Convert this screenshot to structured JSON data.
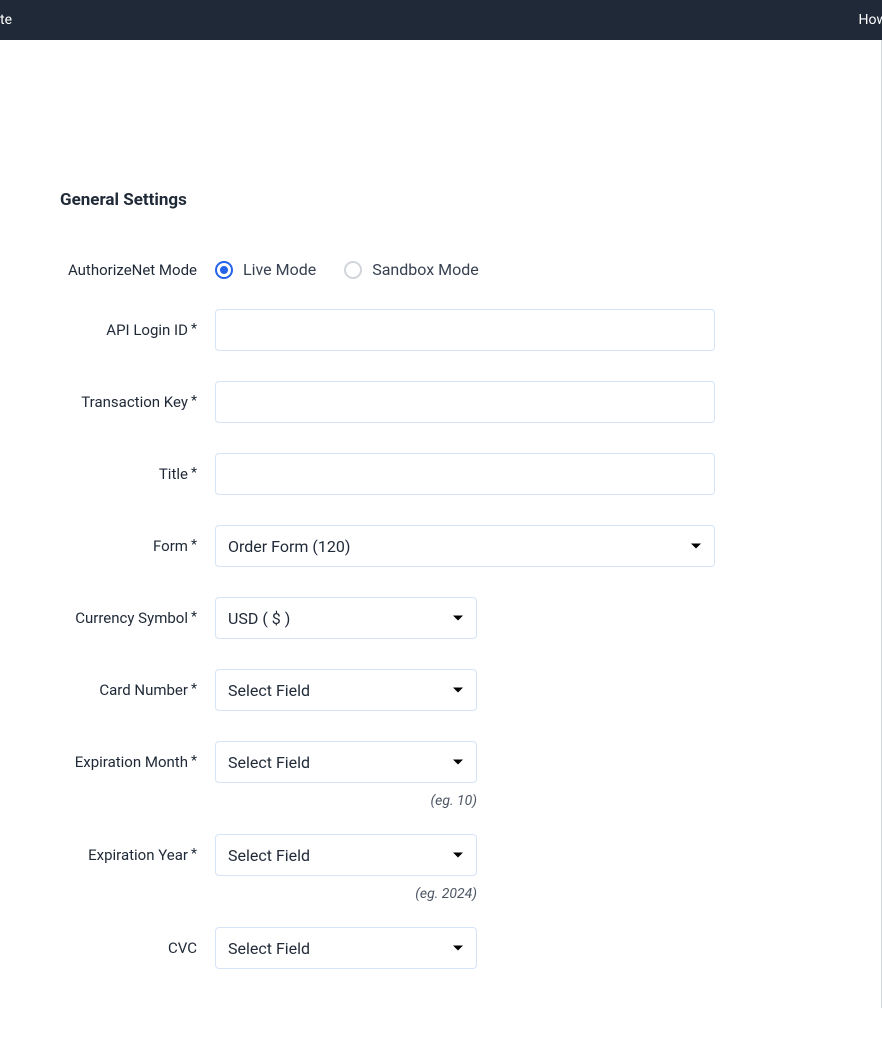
{
  "topbar": {
    "left_text": "te",
    "right_text": "How"
  },
  "section_title": "General Settings",
  "fields": {
    "mode": {
      "label": "AuthorizeNet Mode",
      "option1": "Live Mode",
      "option2": "Sandbox Mode"
    },
    "api_login": {
      "label": "API Login ID",
      "value": ""
    },
    "transaction_key": {
      "label": "Transaction Key",
      "value": ""
    },
    "title": {
      "label": "Title",
      "value": ""
    },
    "form": {
      "label": "Form",
      "value": "Order Form (120)"
    },
    "currency": {
      "label": "Currency Symbol",
      "value": "USD ( $ )"
    },
    "card_number": {
      "label": "Card Number",
      "value": "Select Field"
    },
    "exp_month": {
      "label": "Expiration Month",
      "value": "Select Field",
      "hint": "(eg. 10)"
    },
    "exp_year": {
      "label": "Expiration Year",
      "value": "Select Field",
      "hint": "(eg. 2024)"
    },
    "cvc": {
      "label": "CVC",
      "value": "Select Field"
    }
  }
}
